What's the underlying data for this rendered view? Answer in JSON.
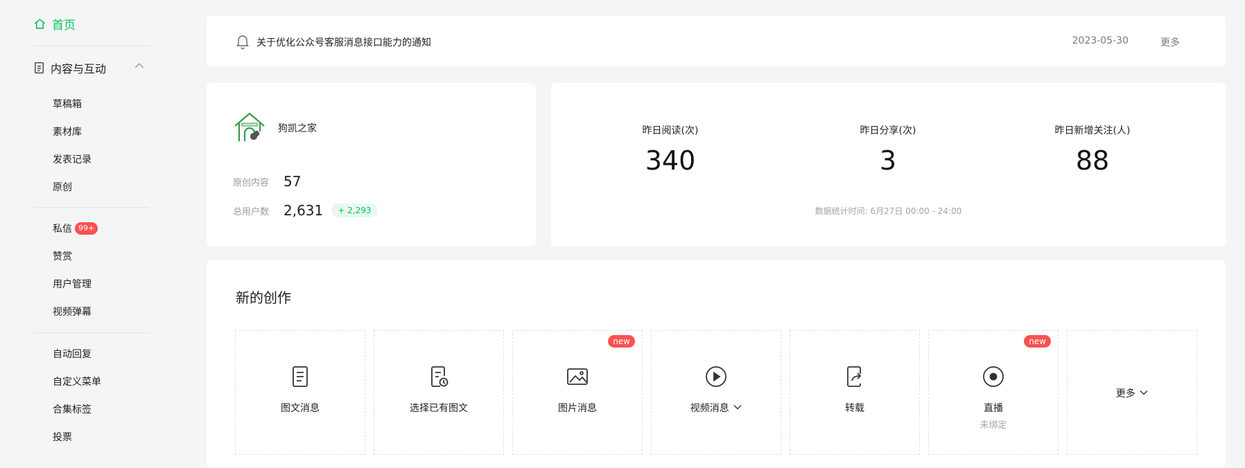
{
  "sidebar": {
    "home": "首页",
    "group": "内容与互动",
    "items": [
      "草稿箱",
      "素材库",
      "发表记录",
      "原创"
    ],
    "items2": [
      "私信",
      "赞赏",
      "用户管理",
      "视频弹幕"
    ],
    "items3": [
      "自动回复",
      "自定义菜单",
      "合集标签",
      "投票"
    ],
    "dm_badge": "99+"
  },
  "notice": {
    "text": "关于优化公众号客服消息接口能力的通知",
    "date": "2023-05-30",
    "more": "更多"
  },
  "account": {
    "name": "狗凯之家",
    "original_label": "原创内容",
    "original_value": "57",
    "users_label": "总用户数",
    "users_value": "2,631",
    "users_growth": "+ 2,293"
  },
  "stats": {
    "metrics": [
      {
        "label": "昨日阅读(次)",
        "value": "340"
      },
      {
        "label": "昨日分享(次)",
        "value": "3"
      },
      {
        "label": "昨日新增关注(人)",
        "value": "88"
      }
    ],
    "note": "数据统计时间: 6月27日 00:00 - 24:00"
  },
  "create": {
    "title": "新的创作",
    "tiles": [
      {
        "label": "图文消息",
        "icon": "article-icon"
      },
      {
        "label": "选择已有图文",
        "icon": "existing-article-icon"
      },
      {
        "label": "图片消息",
        "icon": "image-icon",
        "tag": "new"
      },
      {
        "label": "视频消息",
        "icon": "play-icon"
      },
      {
        "label": "转载",
        "icon": "repost-icon"
      },
      {
        "label": "直播",
        "icon": "live-icon",
        "tag": "new",
        "sub": "未绑定"
      },
      {
        "label": "更多"
      }
    ]
  },
  "colors": {
    "accent": "#07c160",
    "badge": "#fa5151",
    "background": "#f4f5f7"
  }
}
